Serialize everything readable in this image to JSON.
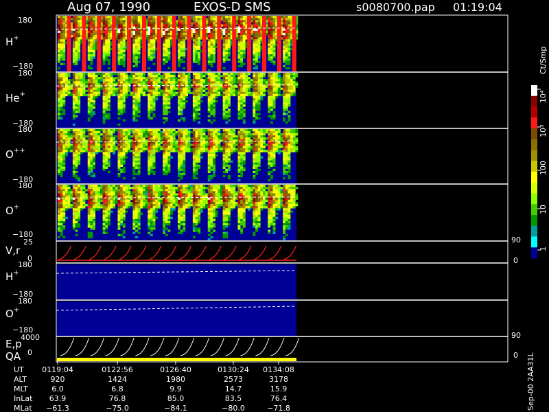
{
  "header": {
    "date": "Aug 07, 1990",
    "mission": "EXOS-D SMS",
    "file": "s0080700.pap",
    "time": "01:19:04"
  },
  "colorbar": {
    "title": "Ct/Smp",
    "ticks": [
      "10⁴",
      "10³",
      "100",
      "10",
      "1"
    ],
    "colors": [
      "#ffffff",
      "#8b0000",
      "#b40000",
      "#ff1a1a",
      "#7a4a00",
      "#8b6f00",
      "#9e8e00",
      "#c8c800",
      "#ffff00",
      "#d8ff00",
      "#8cff00",
      "#44cc00",
      "#009900",
      "#00a0a0",
      "#00ffff",
      "#000096"
    ]
  },
  "panels": [
    {
      "id": "h-plus",
      "label": "H",
      "sup": "+",
      "ymax": "180",
      "ymin": "−180",
      "activity": 0.95
    },
    {
      "id": "he-plus",
      "label": "He",
      "sup": "+",
      "ymax": "180",
      "ymin": "−180",
      "activity": 0.75
    },
    {
      "id": "o-plus-plus",
      "label": "O",
      "sup": "++",
      "ymax": "180",
      "ymin": "−180",
      "activity": 0.8
    },
    {
      "id": "o-plus",
      "label": "O",
      "sup": "+",
      "ymax": "180",
      "ymin": "−180",
      "activity": 0.85
    }
  ],
  "vr_panel": {
    "label": "V,r",
    "left_ticks": [
      "25",
      "0"
    ],
    "right_ticks": [
      "90",
      "0"
    ]
  },
  "h_plus_2": {
    "label": "H",
    "sup": "+",
    "ymax": "180",
    "ymin": "−180"
  },
  "o_plus_2": {
    "label": "O",
    "sup": "+",
    "ymax": "180",
    "ymin": "−180"
  },
  "ep_panel": {
    "label_top": "E,p",
    "label_bottom": "QA",
    "left_ticks": [
      "4000",
      "0"
    ],
    "right_ticks": [
      "90",
      "0"
    ]
  },
  "chart_data": {
    "type": "heatmap",
    "title": "Aug 07, 1990   EXOS-D SMS",
    "x": [
      "0119:04",
      "0122:56",
      "0126:40",
      "0130:24",
      "0134:08"
    ],
    "ylim": [
      -180,
      180
    ],
    "series": [
      {
        "name": "H+",
        "values": [
          0.95
        ]
      },
      {
        "name": "He+",
        "values": [
          0.75
        ]
      },
      {
        "name": "O++",
        "values": [
          0.8
        ]
      },
      {
        "name": "O+",
        "values": [
          0.85
        ]
      }
    ],
    "sweeps": 16
  },
  "ephemeris": {
    "labels": [
      "UT",
      "ALT",
      "MLT",
      "InLat",
      "MLat"
    ],
    "columns": [
      [
        "0119:04",
        "920",
        "6.0",
        "63.9",
        "−61.3"
      ],
      [
        "0122:56",
        "1424",
        "6.8",
        "76.8",
        "−75.0"
      ],
      [
        "0126:40",
        "1980",
        "9.9",
        "85.0",
        "−84.1"
      ],
      [
        "0130:24",
        "2573",
        "14.7",
        "83.5",
        "−80.0"
      ],
      [
        "0134:08",
        "3178",
        "15.9",
        "76.4",
        "−71.8"
      ]
    ]
  },
  "footer_id": "Sep-00  2AA31L"
}
